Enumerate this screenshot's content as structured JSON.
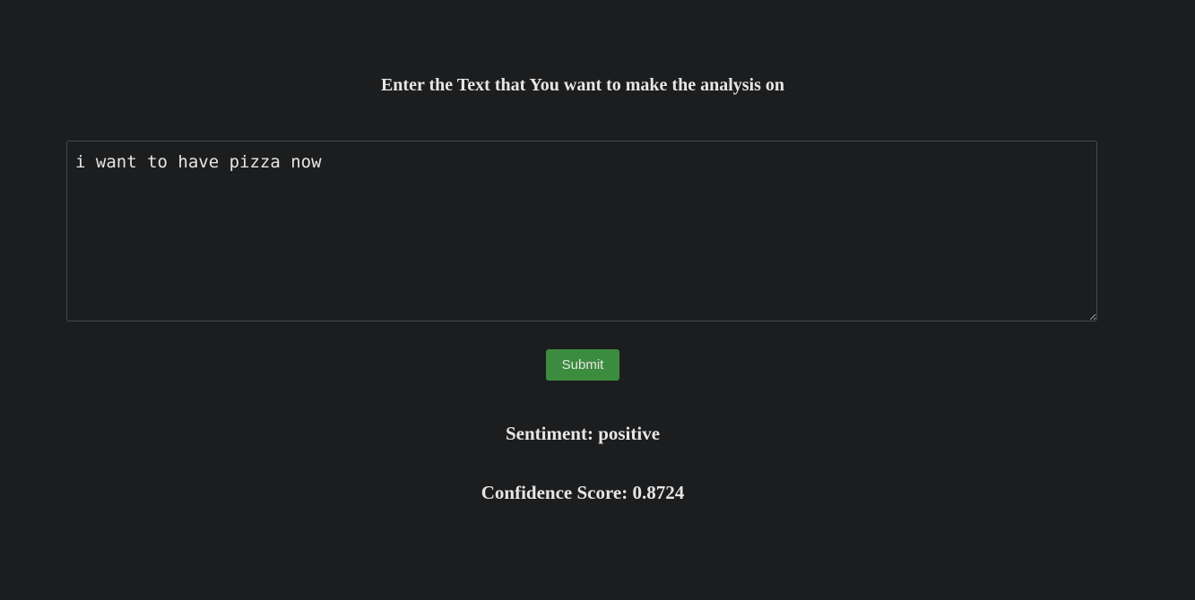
{
  "header": {
    "title": "Enter the Text that You want to make the analysis on"
  },
  "input": {
    "value": "i want to have pizza now"
  },
  "submit": {
    "label": "Submit"
  },
  "result": {
    "sentiment": "Sentiment: positive",
    "confidence": "Confidence Score: 0.8724"
  }
}
